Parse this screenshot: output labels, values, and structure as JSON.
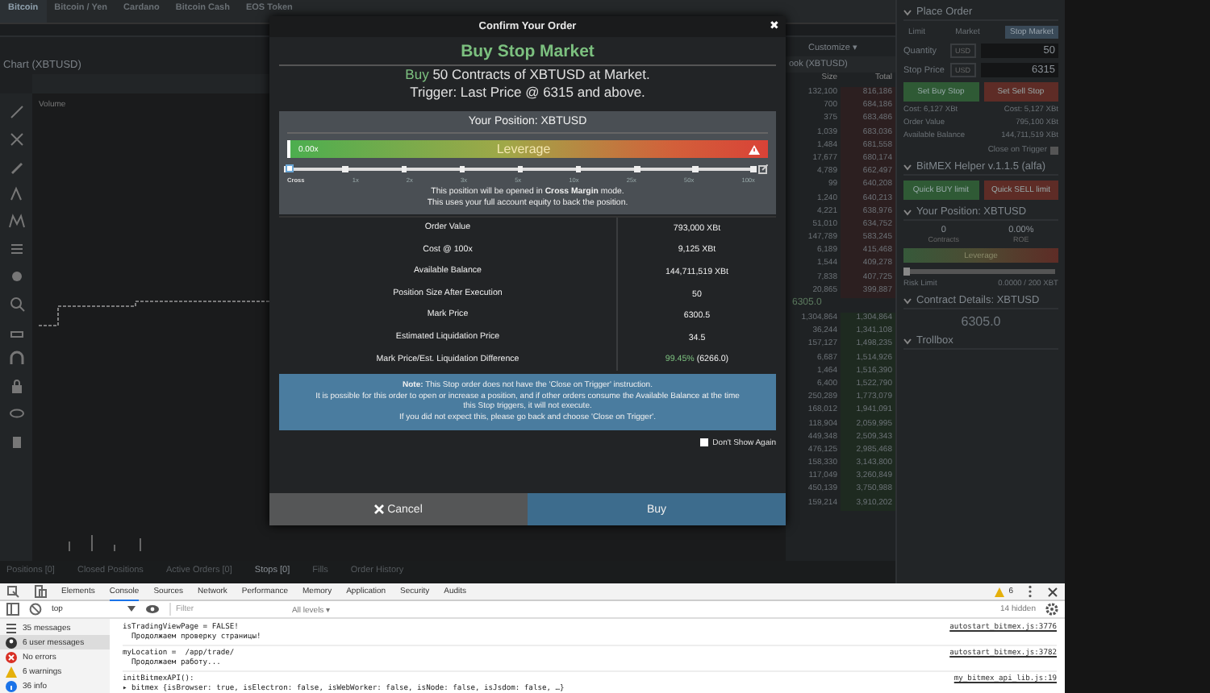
{
  "tickers": [
    {
      "name": "Bitcoin",
      "selected": true
    },
    {
      "name": "Bitcoin / Yen",
      "selected": false
    },
    {
      "name": "Cardano",
      "selected": false
    },
    {
      "name": "Bitcoin Cash",
      "selected": false
    },
    {
      "name": "EOS Token",
      "selected": false
    }
  ],
  "chart": {
    "title": "Chart (XBTUSD)",
    "legend": "Volume"
  },
  "order_book": {
    "title": "ook (XBTUSD)",
    "customize": "Customize ▾",
    "columns": [
      "Size",
      "Total"
    ],
    "asks": [
      [
        "132,100",
        "816,186"
      ],
      [
        "700",
        "684,186"
      ],
      [
        "375",
        "683,486"
      ],
      [
        "1,039",
        "683,036"
      ],
      [
        "1,484",
        "681,558"
      ],
      [
        "17,677",
        "680,174"
      ],
      [
        "4,789",
        "662,497"
      ],
      [
        "99",
        "640,208"
      ],
      [
        "1,240",
        "640,213"
      ],
      [
        "4,221",
        "638,976"
      ],
      [
        "51,010",
        "634,752"
      ],
      [
        "147,789",
        "583,245"
      ],
      [
        "6,189",
        "415,468"
      ],
      [
        "1,544",
        "409,278"
      ],
      [
        "7,838",
        "407,725"
      ],
      [
        "20,865",
        "399,887"
      ]
    ],
    "mid": "6305.0",
    "bids": [
      [
        "1,304,864",
        "1,304,864"
      ],
      [
        "36,244",
        "1,341,108"
      ],
      [
        "157,127",
        "1,498,235"
      ],
      [
        "6,687",
        "1,514,926"
      ],
      [
        "1,464",
        "1,516,390"
      ],
      [
        "6,400",
        "1,522,790"
      ],
      [
        "250,289",
        "1,773,079"
      ],
      [
        "168,012",
        "1,941,091"
      ],
      [
        "118,904",
        "2,059,995"
      ],
      [
        "449,348",
        "2,509,343"
      ],
      [
        "476,125",
        "2,985,468"
      ],
      [
        "158,330",
        "3,143,800"
      ],
      [
        "117,049",
        "3,260,849"
      ],
      [
        "450,139",
        "3,750,988"
      ],
      [
        "159,214",
        "3,910,202"
      ]
    ]
  },
  "bottom_tabs": [
    {
      "label": "Positions [0]",
      "selected": false
    },
    {
      "label": "Closed Positions",
      "selected": false
    },
    {
      "label": "Active Orders [0]",
      "selected": false
    },
    {
      "label": "Stops [0]",
      "selected": true
    },
    {
      "label": "Fills",
      "selected": false
    },
    {
      "label": "Order History",
      "selected": false
    }
  ],
  "panel": [
    {
      "kind": "header",
      "text": "Place Order"
    },
    {
      "kind": "tabs",
      "tabs": [
        {
          "label": "Limit",
          "selected": false
        },
        {
          "label": "Market",
          "selected": false
        },
        {
          "label": "Stop Market",
          "selected": true
        }
      ]
    },
    {
      "kind": "field",
      "label": "Quantity",
      "unit": "USD",
      "value": "50"
    },
    {
      "kind": "field",
      "label": "Stop Price",
      "unit": "USD",
      "value": "6315"
    },
    {
      "kind": "buttons",
      "buttons": [
        {
          "label": "Set Buy Stop",
          "kind": "buy"
        },
        {
          "label": "Set Sell Stop",
          "kind": "sell"
        }
      ]
    },
    {
      "kind": "pair",
      "left": "Cost: 6,127 XBt",
      "right": "Cost: 5,127 XBt"
    },
    {
      "kind": "pair",
      "left": "Order Value",
      "right": "795,100 XBt"
    },
    {
      "kind": "pair",
      "left": "Available Balance",
      "right": "144,711,519 XBt"
    },
    {
      "kind": "check",
      "label": "Close on Trigger",
      "checked": false
    },
    {
      "kind": "header",
      "text": "BitMEX Helper v.1.1.5 (alfa)"
    },
    {
      "kind": "buttons",
      "buttons": [
        {
          "label": "Quick BUY limit",
          "kind": "buy"
        },
        {
          "label": "Quick SELL limit",
          "kind": "sell"
        }
      ]
    },
    {
      "kind": "header",
      "text": "Your Position: XBTUSD"
    },
    {
      "kind": "stats",
      "items": [
        {
          "value": "0",
          "label": "Contracts"
        },
        {
          "value": "0.00%",
          "label": "ROE"
        }
      ]
    },
    {
      "kind": "leverage",
      "label": "Leverage",
      "level": 0
    },
    {
      "kind": "pair",
      "left": "Risk Limit",
      "right": "0.0000 / 200 XBT"
    },
    {
      "kind": "header",
      "text": "Contract Details: XBTUSD"
    },
    {
      "kind": "price",
      "text": "6305.0"
    },
    {
      "kind": "header",
      "text": "Trollbox"
    }
  ],
  "modal": {
    "title": "Confirm Your Order",
    "close": "✖",
    "heading": "Buy Stop Market",
    "summary": [
      "*Buy* 50 Contracts of XBTUSD at Market.",
      "Trigger: Last Price @ 6315 and above."
    ],
    "position_title": "Your Position: XBTUSD",
    "leverage": {
      "value": "0.00x",
      "label": "Leverage",
      "level": 0,
      "ticks": [
        "Cross",
        "1x",
        "2x",
        "3x",
        "5x",
        "10x",
        "25x",
        "50x",
        "100x"
      ]
    },
    "margin_note": [
      "This position will be opened in **Cross Margin** mode.",
      "This uses your full account equity to back the position."
    ],
    "rows": [
      {
        "label": "Order Value",
        "value": "793,000 XBt"
      },
      {
        "label": "Cost @ 100x",
        "value": "9,125 XBt"
      },
      {
        "label": "Available Balance",
        "value": "144,711,519 XBt"
      },
      {
        "label": "Position Size After Execution",
        "value": "50"
      },
      {
        "label": "Mark Price",
        "value": "6300.5"
      },
      {
        "label": "Estimated Liquidation Price",
        "value": "34.5"
      },
      {
        "label": "Mark Price/Est. Liquidation Difference",
        "value": "*99.45%* (6266.0)"
      }
    ],
    "note": "**Note:** This Stop order does not have the 'Close on Trigger' instruction.\nIt is possible for this order to open or increase a position, and if other orders consume the Available Balance at the time\nthis Stop triggers, it will not execute.\nIf you did not expect this, please go back and choose 'Close on Trigger'.",
    "dont_show": {
      "label": "Don't Show Again",
      "checked": false
    },
    "cancel": "Cancel",
    "confirm": "Buy"
  },
  "devtools": {
    "tabs": [
      {
        "label": "Elements",
        "selected": false
      },
      {
        "label": "Console",
        "selected": true
      },
      {
        "label": "Sources",
        "selected": false
      },
      {
        "label": "Network",
        "selected": false
      },
      {
        "label": "Performance",
        "selected": false
      },
      {
        "label": "Memory",
        "selected": false
      },
      {
        "label": "Application",
        "selected": false
      },
      {
        "label": "Security",
        "selected": false
      },
      {
        "label": "Audits",
        "selected": false
      }
    ],
    "warning_count": "6",
    "context": "top",
    "filter_placeholder": "Filter",
    "levels": "All levels ▾",
    "hidden": "14 hidden",
    "sidebar": [
      {
        "kind": "messages",
        "label": "35 messages",
        "selected": false
      },
      {
        "kind": "user",
        "label": "6 user messages",
        "selected": true
      },
      {
        "kind": "errors",
        "label": "No errors",
        "selected": false
      },
      {
        "kind": "warnings",
        "label": "6 warnings",
        "selected": false
      },
      {
        "kind": "info",
        "label": "36 info",
        "selected": false
      }
    ],
    "entries": [
      {
        "lines": [
          "isTradingViewPage = FALSE!",
          "  Продолжаем проверку страницы!"
        ],
        "source": "autostart_bitmex.js:3776"
      },
      {
        "lines": [
          "myLocation =  /app/trade/",
          "  Продолжаем работу..."
        ],
        "source": "autostart_bitmex.js:3782"
      },
      {
        "lines": [
          "initBitmexAPI():",
          "▸ bitmex {isBrowser: true, isElectron: false, isWebWorker: false, isNode: false, isJsdom: false, …}"
        ],
        "source": "my_bitmex_api_lib.js:19"
      }
    ]
  }
}
